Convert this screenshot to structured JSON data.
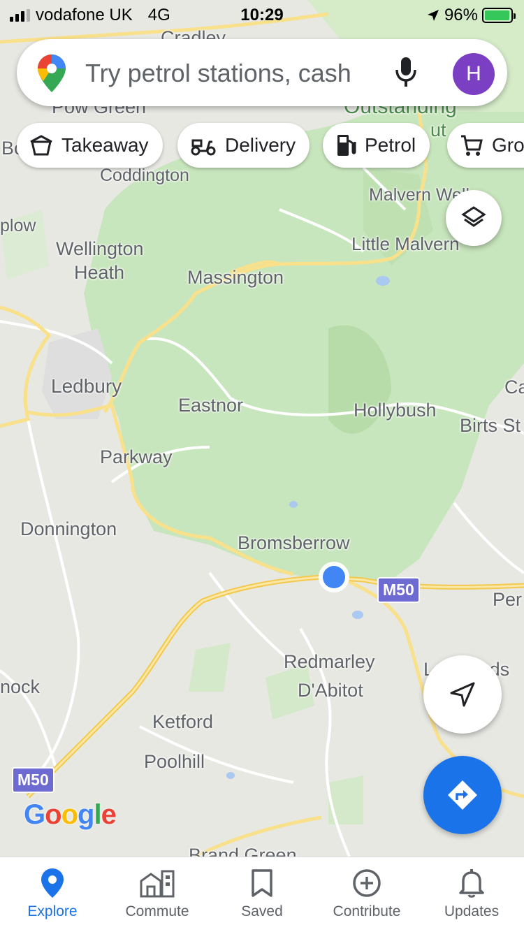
{
  "status_bar": {
    "carrier": "vodafone UK",
    "network": "4G",
    "time": "10:29",
    "battery": "96%"
  },
  "search": {
    "placeholder": "Try petrol stations, cash",
    "avatar_letter": "H"
  },
  "chips": [
    {
      "label": "Takeaway",
      "icon": "takeaway-bag-icon"
    },
    {
      "label": "Delivery",
      "icon": "delivery-scooter-icon"
    },
    {
      "label": "Petrol",
      "icon": "petrol-pump-icon"
    },
    {
      "label": "Gro",
      "icon": "shopping-cart-icon"
    }
  ],
  "map": {
    "places": [
      "Cradley",
      "Pow Green",
      "Outstanding",
      "ut",
      "Bo",
      "Coddington",
      "Malvern Wells",
      "plow",
      "Wellington",
      "Heath",
      "Little Malvern",
      "Massington",
      "Ledbury",
      "Eastnor",
      "Hollybush",
      "Ca",
      "Birts St",
      "Parkway",
      "Donnington",
      "Bromsberrow",
      "Per",
      "Redmarley",
      "D'Abitot",
      "Lowbands",
      "nock",
      "Ketford",
      "Poolhill",
      "Brand Green"
    ],
    "road_shields": [
      "M50",
      "M50"
    ],
    "logo": "Google",
    "colors": {
      "land": "#e8e8e3",
      "park": "#c8e6bd",
      "road": "#f9e08a",
      "location": "#4285f4"
    }
  },
  "bottom_nav": [
    {
      "label": "Explore",
      "icon": "explore-pin-icon",
      "active": true
    },
    {
      "label": "Commute",
      "icon": "commute-building-icon",
      "active": false
    },
    {
      "label": "Saved",
      "icon": "bookmark-icon",
      "active": false
    },
    {
      "label": "Contribute",
      "icon": "add-circle-icon",
      "active": false
    },
    {
      "label": "Updates",
      "icon": "bell-icon",
      "active": false
    }
  ],
  "accent": "#1a73e8"
}
